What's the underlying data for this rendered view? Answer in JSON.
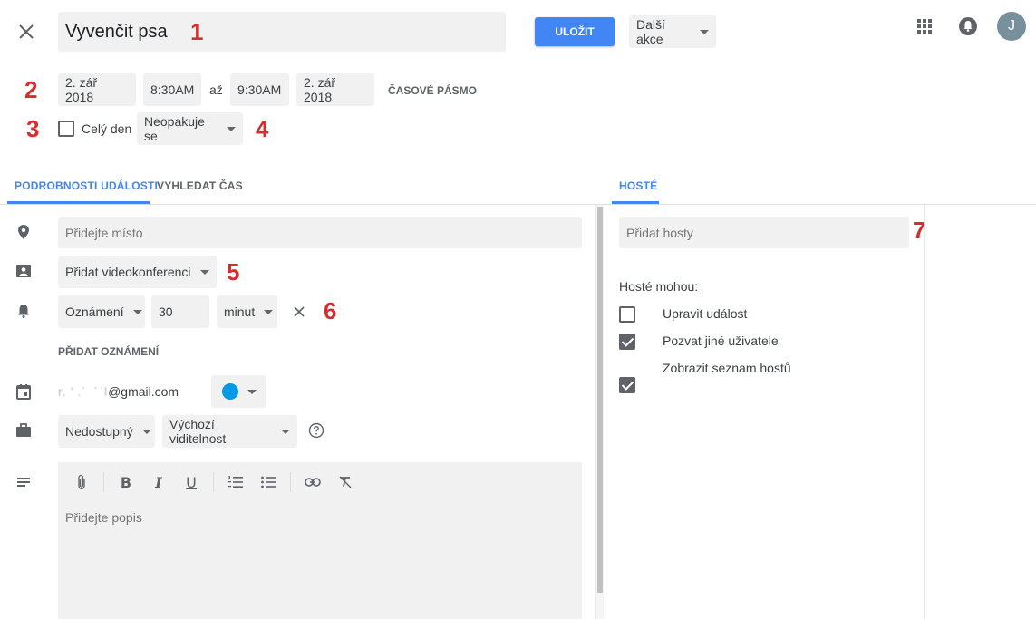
{
  "header": {
    "title": "Vyvenčit psa",
    "save_label": "ULOŽIT",
    "more_actions_label": "Další akce",
    "avatar_letter": "J"
  },
  "datetime": {
    "start_date": "2. zář 2018",
    "start_time": "8:30AM",
    "to_label": "až",
    "end_time": "9:30AM",
    "end_date": "2. zář 2018",
    "timezone_label": "ČASOVÉ PÁSMO",
    "all_day_label": "Celý den",
    "repeat_label": "Neopakuje se"
  },
  "annotations": [
    "1",
    "2",
    "3",
    "4",
    "5",
    "6",
    "7"
  ],
  "tabs": {
    "details": "PODROBNOSTI UDÁLOSTI",
    "find_time": "VYHLEDAT ČAS",
    "guests": "HOSTÉ"
  },
  "details": {
    "location_placeholder": "Přidejte místo",
    "conference_label": "Přidat videokonferenci",
    "notification_type": "Oznámení",
    "notification_value": "30",
    "notification_unit": "minut",
    "add_notification_label": "PŘIDAT OZNÁMENÍ",
    "calendar_email": "@gmail.com",
    "calendar_email_blurred": "r. ’ .´  ´ˈl",
    "calendar_color": "#039be5",
    "availability_label": "Nedostupný",
    "visibility_label": "Výchozí viditelnost",
    "description_placeholder": "Přidejte popis"
  },
  "guests": {
    "add_placeholder": "Přidat hosty",
    "permissions_title": "Hosté mohou:",
    "permissions": [
      {
        "label": "Upravit událost",
        "checked": false
      },
      {
        "label": "Pozvat jiné uživatele",
        "checked": true
      },
      {
        "label": "Zobrazit seznam hostů",
        "checked": true
      }
    ]
  },
  "colors": {
    "accent": "#4285f4",
    "annotation": "#d32f2f"
  }
}
